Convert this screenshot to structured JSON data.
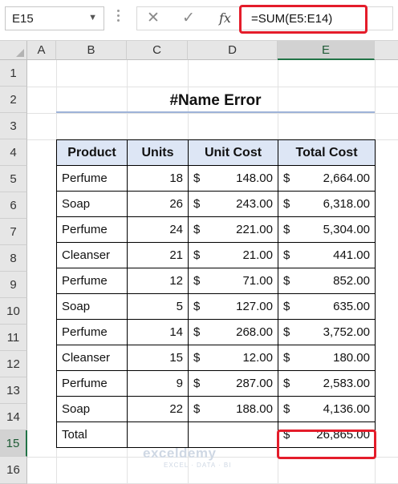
{
  "formula_bar": {
    "name_box": "E15",
    "cancel_glyph": "✕",
    "enter_glyph": "✓",
    "fx_label": "fx",
    "formula": "=SUM(E5:E14)"
  },
  "grid": {
    "columns": [
      "A",
      "B",
      "C",
      "D",
      "E"
    ],
    "rows": [
      "1",
      "2",
      "3",
      "4",
      "5",
      "6",
      "7",
      "8",
      "9",
      "10",
      "11",
      "12",
      "13",
      "14",
      "15",
      "16"
    ],
    "selected_column": "E",
    "selected_row": "15"
  },
  "sheet": {
    "title": "#Name Error",
    "headers": [
      "Product",
      "Units",
      "Unit Cost",
      "Total Cost"
    ],
    "currency_symbol": "$",
    "rows": [
      {
        "product": "Perfume",
        "units": "18",
        "unit_cost": "148.00",
        "total_cost": "2,664.00"
      },
      {
        "product": "Soap",
        "units": "26",
        "unit_cost": "243.00",
        "total_cost": "6,318.00"
      },
      {
        "product": "Perfume",
        "units": "24",
        "unit_cost": "221.00",
        "total_cost": "5,304.00"
      },
      {
        "product": "Cleanser",
        "units": "21",
        "unit_cost": "21.00",
        "total_cost": "441.00"
      },
      {
        "product": "Perfume",
        "units": "12",
        "unit_cost": "71.00",
        "total_cost": "852.00"
      },
      {
        "product": "Soap",
        "units": "5",
        "unit_cost": "127.00",
        "total_cost": "635.00"
      },
      {
        "product": "Perfume",
        "units": "14",
        "unit_cost": "268.00",
        "total_cost": "3,752.00"
      },
      {
        "product": "Cleanser",
        "units": "15",
        "unit_cost": "12.00",
        "total_cost": "180.00"
      },
      {
        "product": "Perfume",
        "units": "9",
        "unit_cost": "287.00",
        "total_cost": "2,583.00"
      },
      {
        "product": "Soap",
        "units": "22",
        "unit_cost": "188.00",
        "total_cost": "4,136.00"
      }
    ],
    "total_label": "Total",
    "total_value": "26,865.00"
  },
  "watermark": {
    "name": "exceldemy",
    "tagline": "EXCEL · DATA · BI"
  },
  "colors": {
    "highlight_red": "#e41c2a",
    "header_fill": "#dde6f5",
    "excel_green": "#217346"
  }
}
